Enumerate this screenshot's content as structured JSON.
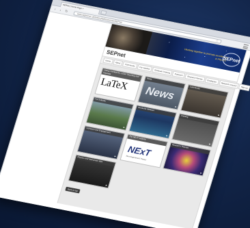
{
  "browser": {
    "tab_title": "SEPnet | Home Page  ×",
    "address": "www.sepnet.ac.uk/index.php/resources/SEPnet"
  },
  "site": {
    "title": "SEPnet",
    "tagline": "Working together to promote excellence in Physics",
    "logo_text": "SEPnet",
    "nav": [
      "Home",
      "About",
      "Community",
      "For industry",
      "Graduate Training",
      "Outreach",
      "Research themes",
      "Employers",
      "Research Council",
      "Sign-up"
    ],
    "tiles": [
      {
        "label": "Using Overleaf for LaTeX Teaching and Tutorials",
        "art": "LaTeX"
      },
      {
        "label": "News",
        "art": "News"
      },
      {
        "label": "Community",
        "art": ""
      },
      {
        "label": "For Industry",
        "art": ""
      },
      {
        "label": "Graduate Network",
        "art": ""
      },
      {
        "label": "Training",
        "art": ""
      },
      {
        "label": "Outreach and Engagement",
        "art": ""
      },
      {
        "label": "The NExT Institute",
        "art": "NExT",
        "sub": "New Experiment Theory"
      },
      {
        "label": "Research Themes",
        "art": ""
      },
      {
        "label": "Physics and Instrument labs",
        "art": ""
      }
    ],
    "footer_button": "Back to top"
  },
  "colors": {
    "background": "#122549",
    "tagline": "#ffd24a",
    "tile_label_bg": "#3c3c3c"
  }
}
